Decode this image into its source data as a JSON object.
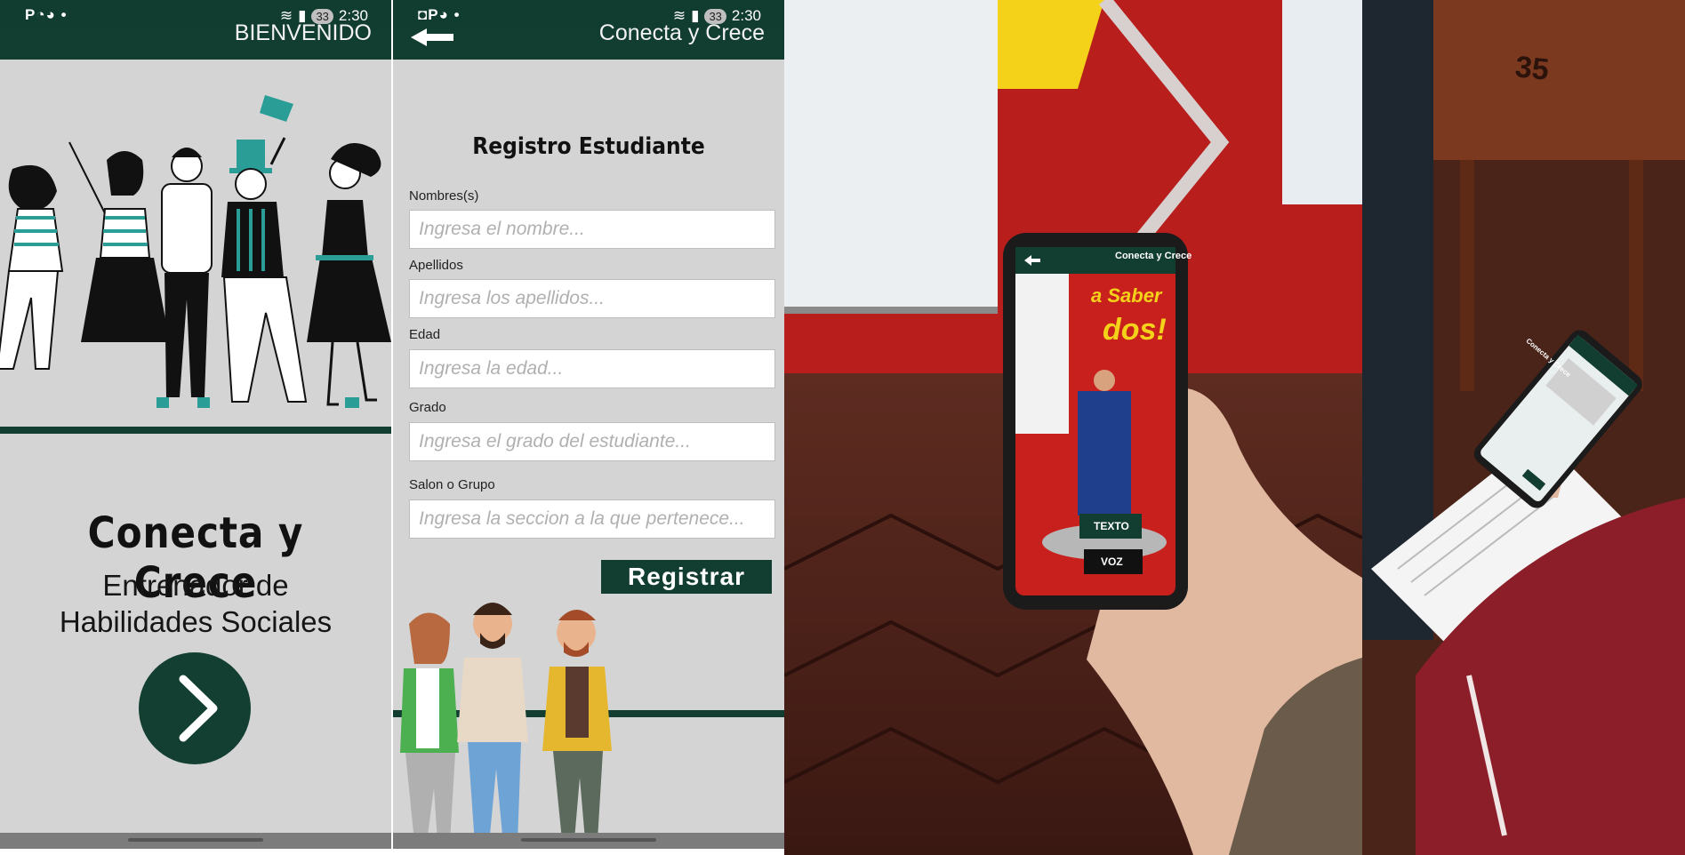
{
  "screen1": {
    "status": {
      "left_icons": "P◔◕ •",
      "battery": "33",
      "time": "2:30"
    },
    "appbar_title": "BIENVENIDO",
    "app_name": "Conecta y Crece",
    "subtitle_line1": "Entrenador de",
    "subtitle_line2": "Habilidades Sociales",
    "next_icon": "chevron-right-icon"
  },
  "screen2": {
    "status": {
      "left_icons": "◘P◕ •",
      "battery": "33",
      "time": "2:30"
    },
    "appbar_title": "Conecta y Crece",
    "back_icon": "arrow-left-icon",
    "form_title": "Registro Estudiante",
    "fields": [
      {
        "label": "Nombres(s)",
        "placeholder": "Ingresa el nombre..."
      },
      {
        "label": "Apellidos",
        "placeholder": "Ingresa los apellidos..."
      },
      {
        "label": "Edad",
        "placeholder": "Ingresa la edad..."
      },
      {
        "label": "Grado",
        "placeholder": "Ingresa el grado del estudiante..."
      },
      {
        "label": "Salon o Grupo",
        "placeholder": "Ingresa la seccion a la que pertenece..."
      }
    ],
    "register_label": "Registrar"
  },
  "photo1": {
    "phone_title": "Conecta y Crece",
    "banner_text_1": "a Saber",
    "banner_text_2": "dos!",
    "button_text": "TEXTO",
    "button_voice": "VOZ"
  },
  "photo2": {
    "phone_title": "Conecta y Crece",
    "desk_number": "35"
  },
  "colors": {
    "primary": "#123d31",
    "screen_bg": "#d4d4d4",
    "accent_teal": "#2a9d96",
    "banner_red": "#c8201d",
    "banner_yellow": "#f4d21a"
  }
}
